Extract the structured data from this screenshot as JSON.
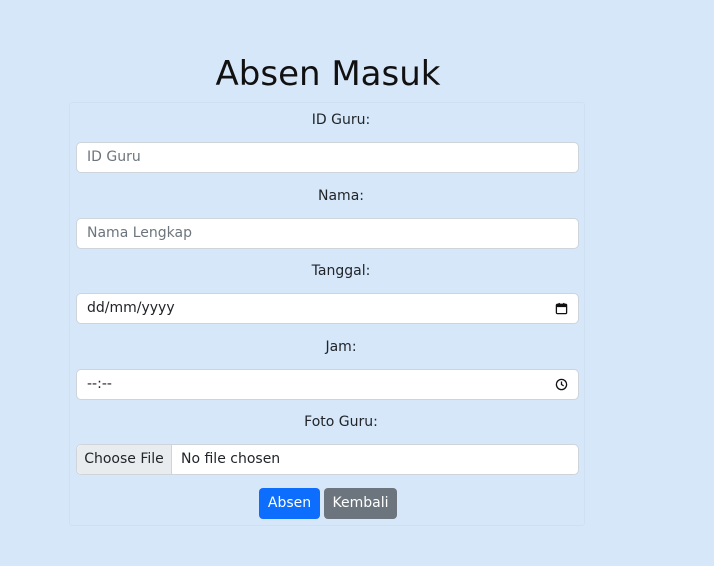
{
  "page": {
    "title": "Absen Masuk"
  },
  "form": {
    "id_guru": {
      "label": "ID Guru:",
      "placeholder": "ID Guru"
    },
    "nama": {
      "label": "Nama:",
      "placeholder": "Nama Lengkap"
    },
    "tanggal": {
      "label": "Tanggal:",
      "value": "dd/mm/yyyy",
      "icon": "calendar-icon"
    },
    "jam": {
      "label": "Jam:",
      "value": "--:--",
      "icon": "clock-icon"
    },
    "foto": {
      "label": "Foto Guru:",
      "button_label": "Choose File",
      "status": "No file chosen"
    }
  },
  "actions": {
    "submit_label": "Absen",
    "back_label": "Kembali"
  },
  "colors": {
    "background": "#d6e7fa",
    "primary": "#0d6efd",
    "secondary": "#6c757d"
  }
}
